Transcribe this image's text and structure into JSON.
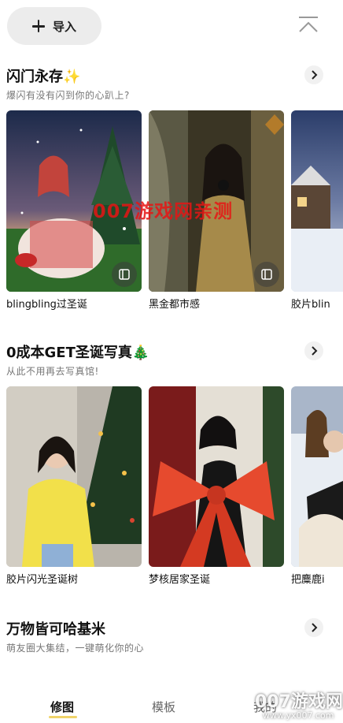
{
  "header": {
    "import_label": "导入"
  },
  "sections": [
    {
      "title": "闪门永存✨",
      "subtitle": "爆闪有没有闪到你的心趴上?",
      "cards": [
        {
          "label": "blingbling过圣诞"
        },
        {
          "label": "黑金都市感"
        },
        {
          "label": "胶片blin"
        }
      ]
    },
    {
      "title": "0成本GET圣诞写真🎄",
      "subtitle": "从此不用再去写真馆!",
      "cards": [
        {
          "label": "胶片闪光圣诞树"
        },
        {
          "label": "梦核居家圣诞"
        },
        {
          "label": "把麋鹿i"
        }
      ]
    },
    {
      "title": "万物皆可哈基米",
      "subtitle": "萌友圈大集结，一键萌化你的心"
    }
  ],
  "watermark": "007游戏网亲测",
  "bottom_nav": [
    {
      "label": "修图",
      "active": true
    },
    {
      "label": "模板",
      "active": false
    },
    {
      "label": "我的",
      "active": false
    }
  ],
  "site_watermark": {
    "title": "007游戏网",
    "url": "www.yx007.com"
  },
  "colors": {
    "accent_underline": "#f0d36a",
    "watermark_red": "#e61414"
  },
  "icons": [
    "plus-icon",
    "collapse-up-icon",
    "chevron-right-icon",
    "play-badge-icon"
  ]
}
